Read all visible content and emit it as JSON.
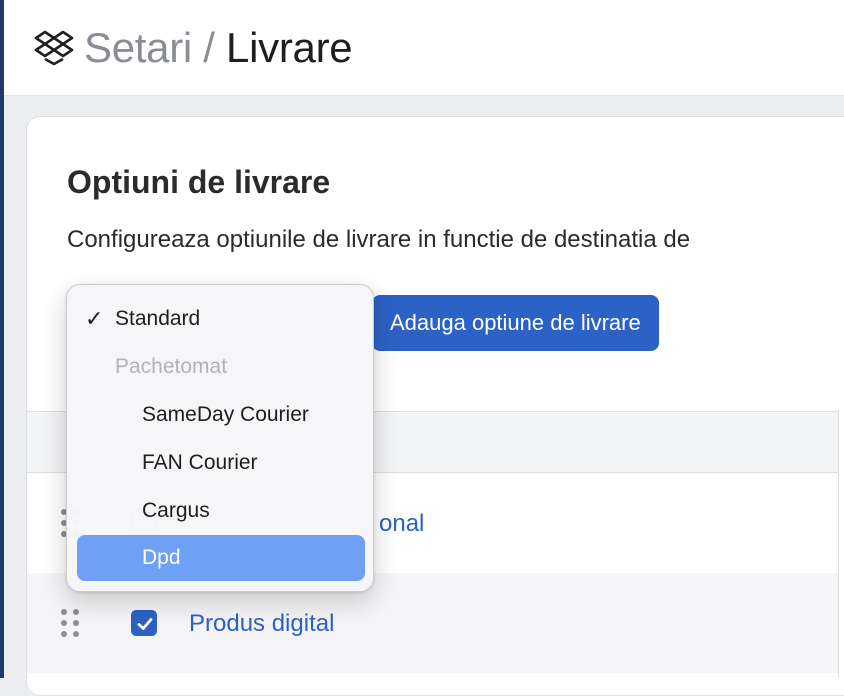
{
  "header": {
    "breadcrumb_parent": "Setari",
    "breadcrumb_separator": "/",
    "breadcrumb_current": "Livrare",
    "icon": "dropbox-icon"
  },
  "card": {
    "title": "Optiuni de livrare",
    "description": "Configureaza optiunile de livrare in functie de destinatia de",
    "add_button_label": "Adauga optiune de livrare"
  },
  "rows": [
    {
      "label": "onal",
      "checked": false
    },
    {
      "label": "Produs digital",
      "checked": true
    }
  ],
  "dropdown": {
    "selected": "Standard",
    "check_mark": "✓",
    "items": [
      {
        "label": "Standard"
      },
      {
        "label": "SameDay Courier"
      },
      {
        "label": "FAN Courier"
      },
      {
        "label": "Cargus"
      },
      {
        "label": "Dpd"
      }
    ],
    "group_label": "Pachetomat",
    "highlighted": "Dpd"
  },
  "colors": {
    "accent": "#2c62c6",
    "highlight": "#6ea1f6",
    "sidebar": "#233a66"
  }
}
